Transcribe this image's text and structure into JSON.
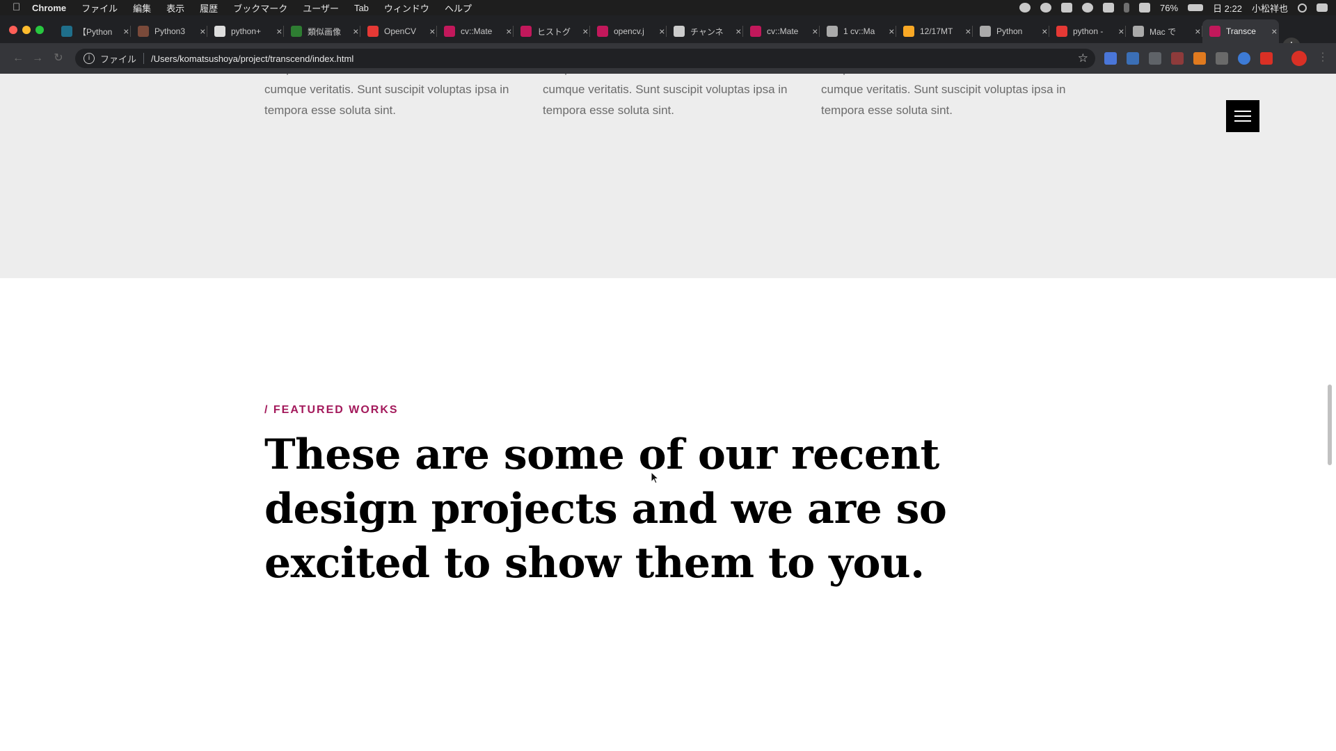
{
  "menubar": {
    "app": "Chrome",
    "items": [
      "ファイル",
      "編集",
      "表示",
      "履歴",
      "ブックマーク",
      "ユーザー",
      "Tab",
      "ウィンドウ",
      "ヘルプ"
    ],
    "battery": "76%",
    "clock": "日 2:22",
    "user": "小松祥也"
  },
  "tabs": [
    {
      "label": "【Python",
      "favicon_color": "#1f6f8b"
    },
    {
      "label": "Python3",
      "favicon_color": "#7a4a3a"
    },
    {
      "label": "python+",
      "favicon_color": "#dddddd"
    },
    {
      "label": "類似画像",
      "favicon_color": "#2e7d32"
    },
    {
      "label": "OpenCV",
      "favicon_color": "#e53935"
    },
    {
      "label": "cv::Mate",
      "favicon_color": "#c2185b"
    },
    {
      "label": "ヒストグ",
      "favicon_color": "#c2185b"
    },
    {
      "label": "opencv.j",
      "favicon_color": "#c2185b"
    },
    {
      "label": "チャンネ",
      "favicon_color": "#cccccc"
    },
    {
      "label": "cv::Mate",
      "favicon_color": "#c2185b"
    },
    {
      "label": "1 cv::Ma",
      "favicon_color": "#aaaaaa"
    },
    {
      "label": "12/17MT",
      "favicon_color": "#f9a825"
    },
    {
      "label": "Python",
      "favicon_color": "#aaaaaa"
    },
    {
      "label": "python -",
      "favicon_color": "#e53935"
    },
    {
      "label": "Mac で",
      "favicon_color": "#aaaaaa"
    },
    {
      "label": "Transce",
      "favicon_color": "#c2185b",
      "active": true
    }
  ],
  "omnibox": {
    "scheme": "ファイル",
    "url": "/Users/komatsushoya/project/transcend/index.html"
  },
  "page": {
    "columns": [
      "voluptas ab sit natus veritatis ut. Debitis nulla cumque veritatis. Sunt suscipit voluptas ipsa in tempora esse soluta sint.",
      "voluptas ab sit natus veritatis ut. Debitis nulla cumque veritatis. Sunt suscipit voluptas ipsa in tempora esse soluta sint.",
      "voluptas ab sit natus veritatis ut. Debitis nulla cumque veritatis. Sunt suscipit voluptas ipsa in tempora esse soluta sint."
    ],
    "eyebrow": "/ FEATURED WORKS",
    "headline": "These are some of our recent design projects and we are so excited to show them to you."
  },
  "colors": {
    "accent": "#a3195b",
    "grey_section": "#ededed"
  }
}
